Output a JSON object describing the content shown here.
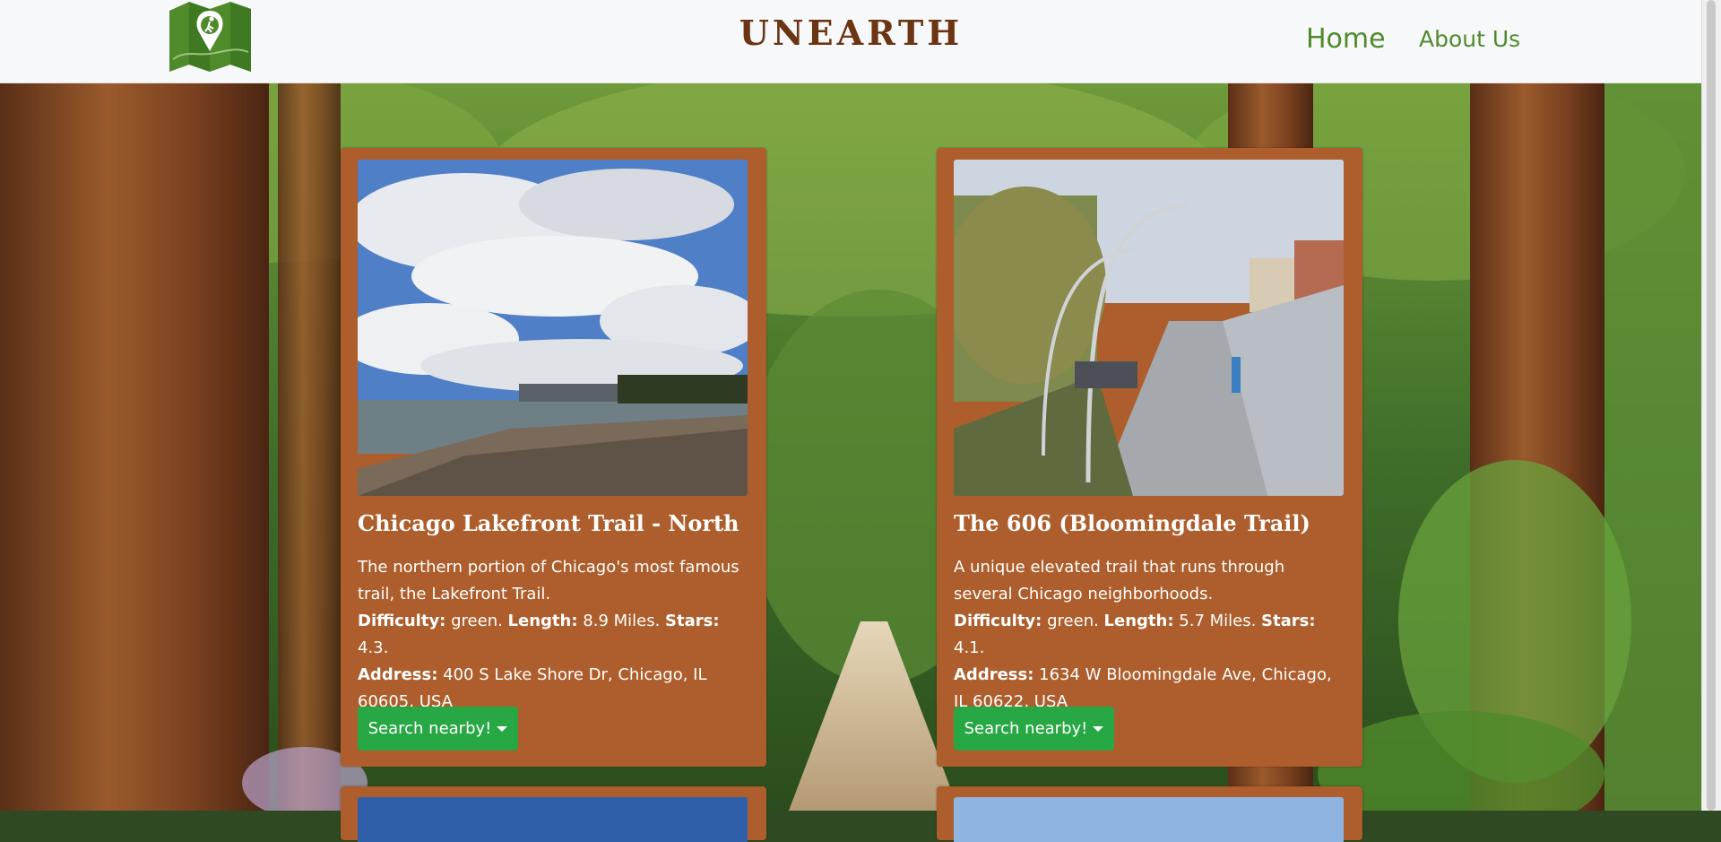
{
  "header": {
    "brand": "UNEARTH",
    "nav": {
      "home": "Home",
      "about": "About Us"
    }
  },
  "cards": [
    {
      "title": "Chicago Lakefront Trail - North",
      "description": "The northern portion of Chicago's most famous trail, the Lakefront Trail.",
      "difficulty_label": "Difficulty:",
      "difficulty": " green. ",
      "length_label": "Length:",
      "length": " 8.9 Miles. ",
      "stars_label": "Stars:",
      "stars": " 4.3.",
      "address_label": "Address:",
      "address": " 400 S Lake Shore Dr, Chicago, IL 60605, USA",
      "button": "Search nearby!"
    },
    {
      "title": "The 606 (Bloomingdale Trail)",
      "description": "A unique elevated trail that runs through several Chicago neighborhoods.",
      "difficulty_label": "Difficulty:",
      "difficulty": " green. ",
      "length_label": "Length:",
      "length": " 5.7 Miles. ",
      "stars_label": "Stars:",
      "stars": " 4.1.",
      "address_label": "Address:",
      "address": " 1634 W Bloomingdale Ave, Chicago, IL 60622, USA",
      "button": "Search nearby!"
    }
  ],
  "colors": {
    "brand": "#6b3412",
    "nav_link": "#4f8a2b",
    "card_bg": "#ad5e2c",
    "button_bg": "#28a745",
    "logo_green": "#4f8a2b"
  },
  "icons": {
    "logo": "hiker-map-logo",
    "button_caret": "caret-down-icon"
  }
}
